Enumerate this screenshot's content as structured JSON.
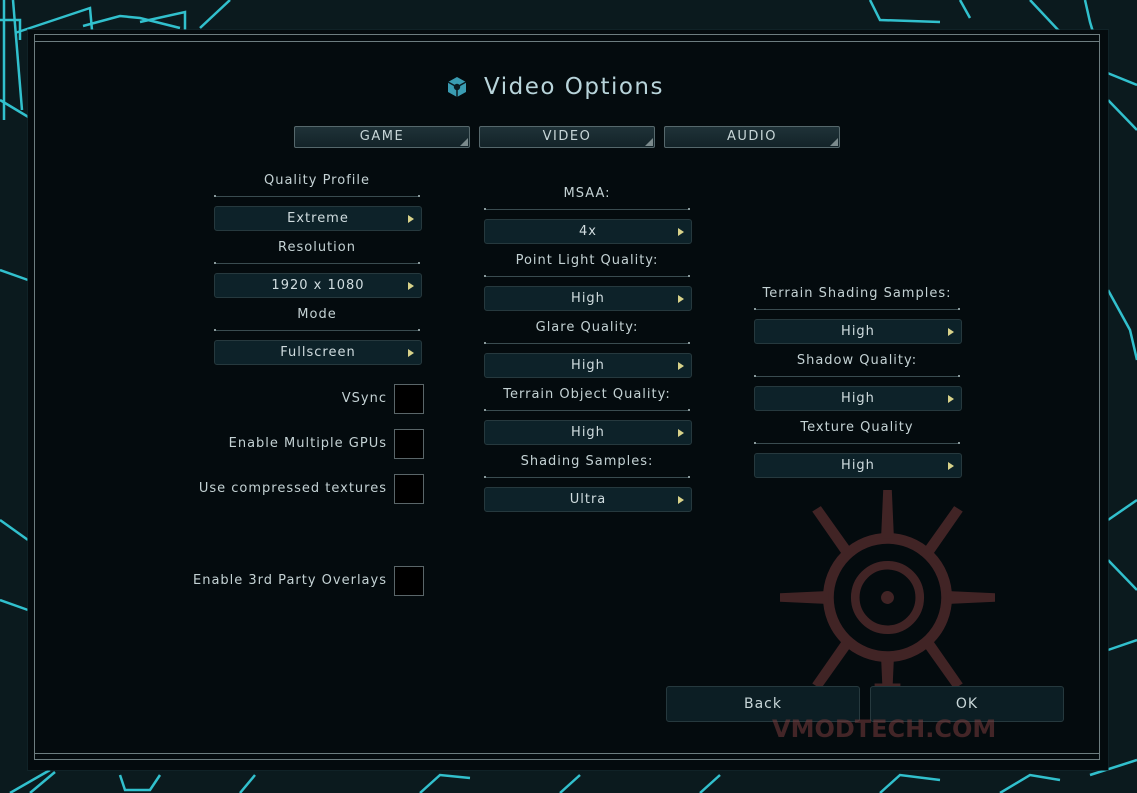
{
  "title": "Video Options",
  "tabs": [
    {
      "label": "GAME"
    },
    {
      "label": "VIDEO"
    },
    {
      "label": "AUDIO"
    }
  ],
  "left_column": {
    "settings": [
      {
        "label": "Quality Profile",
        "value": "Extreme"
      },
      {
        "label": "Resolution",
        "value": "1920 x 1080"
      },
      {
        "label": "Mode",
        "value": "Fullscreen"
      }
    ],
    "checkboxes": [
      {
        "label": "VSync",
        "checked": false
      },
      {
        "label": "Enable Multiple GPUs",
        "checked": false
      },
      {
        "label": "Use compressed textures",
        "checked": false
      },
      {
        "label": "Enable 3rd Party Overlays",
        "checked": false
      }
    ]
  },
  "middle_column": {
    "settings": [
      {
        "label": "MSAA:",
        "value": "4x"
      },
      {
        "label": "Point Light Quality:",
        "value": "High"
      },
      {
        "label": "Glare Quality:",
        "value": "High"
      },
      {
        "label": "Terrain Object Quality:",
        "value": "High"
      },
      {
        "label": "Shading Samples:",
        "value": "Ultra"
      }
    ]
  },
  "right_column": {
    "settings": [
      {
        "label": "Terrain Shading Samples:",
        "value": "High"
      },
      {
        "label": "Shadow Quality:",
        "value": "High"
      },
      {
        "label": "Texture Quality",
        "value": "High"
      }
    ]
  },
  "buttons": {
    "back": "Back",
    "ok": "OK"
  },
  "watermark": "VMODTECH.COM",
  "colors": {
    "accent_cyan": "#2fd6e6",
    "arrow_yellow": "#d8d28a",
    "panel_bg": "#040b0e",
    "control_bg": "#0d2229"
  }
}
